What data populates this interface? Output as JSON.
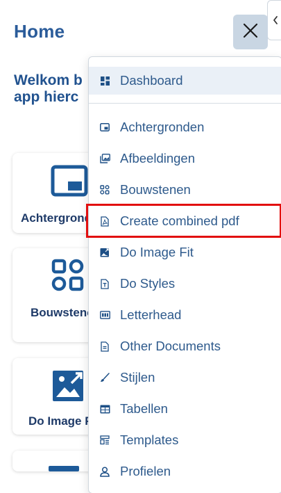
{
  "header": {
    "title": "Home",
    "close_icon": "close-icon",
    "collapse_icon": "chevron-left-icon"
  },
  "welcome": {
    "line1": "Welkom b",
    "line2": "app hierc"
  },
  "cards": [
    {
      "label": "Achtergronden",
      "icon": "background-icon"
    },
    {
      "label": "Bouwstenen",
      "icon": "building-blocks-icon"
    },
    {
      "label": "Do Image Fit",
      "icon": "image-fit-icon"
    },
    {
      "label": "",
      "icon": "card-icon"
    }
  ],
  "menu": {
    "items": [
      {
        "label": "Dashboard",
        "icon": "dashboard-icon",
        "active": true
      },
      {
        "label": "Achtergronden",
        "icon": "background-icon"
      },
      {
        "label": "Afbeeldingen",
        "icon": "images-icon"
      },
      {
        "label": "Bouwstenen",
        "icon": "building-blocks-icon"
      },
      {
        "label": "Create combined pdf",
        "icon": "pdf-file-icon",
        "highlighted": true
      },
      {
        "label": "Do Image Fit",
        "icon": "image-fit-icon"
      },
      {
        "label": "Do Styles",
        "icon": "styles-file-icon"
      },
      {
        "label": "Letterhead",
        "icon": "letterhead-icon"
      },
      {
        "label": "Other Documents",
        "icon": "document-icon"
      },
      {
        "label": "Stijlen",
        "icon": "brush-icon"
      },
      {
        "label": "Tabellen",
        "icon": "table-icon"
      },
      {
        "label": "Templates",
        "icon": "templates-icon"
      },
      {
        "label": "Profielen",
        "icon": "user-icon"
      }
    ]
  },
  "colors": {
    "accent": "#2b5c9a",
    "icon": "#1d5a99",
    "highlight_border": "#e20f0f",
    "active_bg": "#eaf0f7"
  }
}
